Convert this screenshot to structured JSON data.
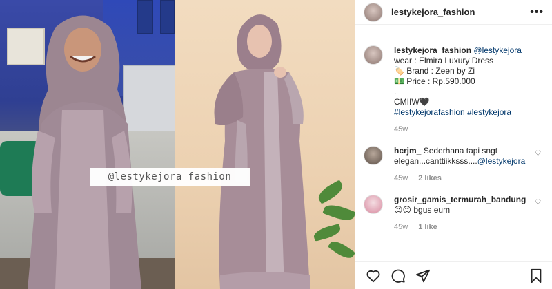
{
  "post": {
    "username": "lestykejora_fashion",
    "watermark": "@lestykejora_fashion"
  },
  "caption": {
    "username": "lestykejora_fashion",
    "mention": "@lestykejora",
    "line_wear": "wear : Elmira Luxury Dress",
    "line_brand": "Brand : Zeen by Zi",
    "line_price": "Price : Rp.590.000",
    "line_dot": ".",
    "line_cmiiw": "CMIIW",
    "hashtags": "#lestykejorafashion #lestykejora",
    "time": "45w"
  },
  "comments": [
    {
      "username": "hcrjm_",
      "text": "Sederhana tapi sngt elegan...canttiikksss....",
      "mention": "@lestykejora",
      "time": "45w",
      "likes": "2 likes"
    },
    {
      "username": "grosir_gamis_termurah_bandung",
      "emoji": "😍😍",
      "text": "bgus eum",
      "time": "45w",
      "likes": "1 like"
    }
  ],
  "icons": {
    "more": "more-options-icon",
    "like": "heart-icon",
    "comment": "comment-icon",
    "share": "share-icon",
    "save": "bookmark-icon",
    "brand_emoji": "label-tag-emoji",
    "price_emoji": "money-emoji",
    "heart_emoji": "black-heart-emoji"
  },
  "glyphs": {
    "more": "•••",
    "comment_heart": "♡",
    "brand_emoji": "🏷️",
    "price_emoji": "💵",
    "black_heart": "🖤"
  }
}
